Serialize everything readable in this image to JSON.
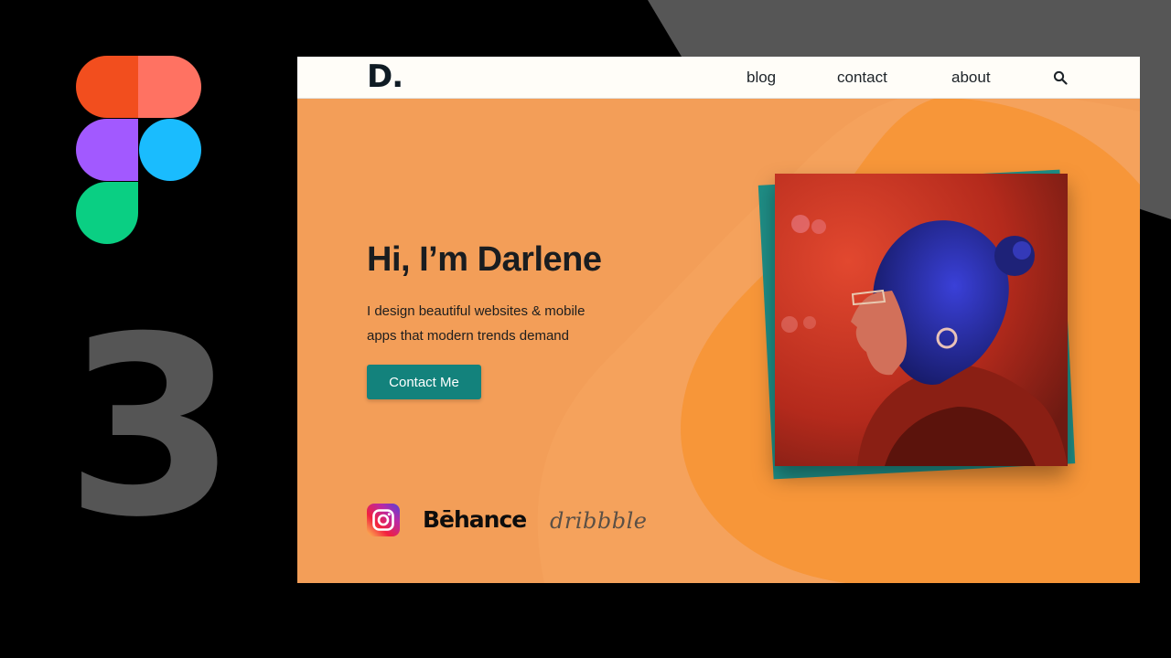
{
  "site": {
    "logo": "D.",
    "nav": {
      "blog": "blog",
      "contact": "contact",
      "about": "about"
    },
    "hero": {
      "title": "Hi, I’m Darlene",
      "description_line1": "I design beautiful websites & mobile",
      "description_line2": "apps that modern trends demand",
      "cta_label": "Contact Me"
    },
    "social": {
      "behance": "Bēhance",
      "dribbble": "dribbble"
    }
  },
  "episode_number": "3",
  "icons": [
    "figma-logo-icon",
    "search-icon",
    "instagram-icon"
  ],
  "colors": {
    "page_background": "#000000",
    "site_background": "#F39E58",
    "accent_teal": "#13827C",
    "navbar_background": "#FFFDF8",
    "number_gray": "#555555"
  }
}
